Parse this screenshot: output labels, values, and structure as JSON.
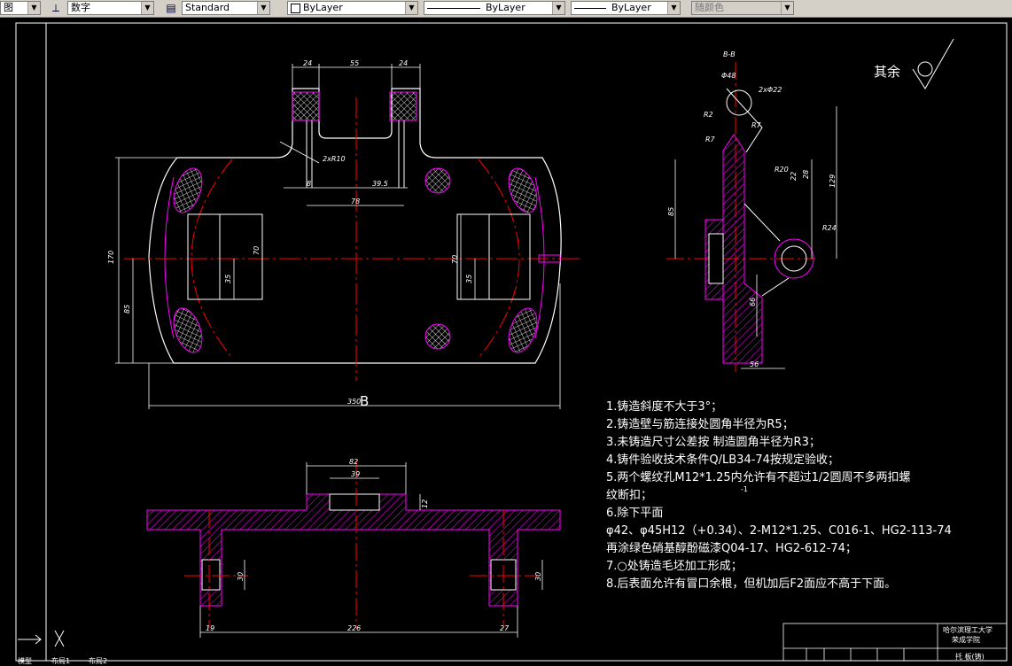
{
  "toolbar": {
    "partial_left": "图",
    "dimstyle_value": "数字",
    "textstyle_value": "Standard",
    "layer_value": "ByLayer",
    "linetype_value": "ByLayer",
    "lineweight_value": "ByLayer",
    "plotstyle_value": "随颜色"
  },
  "drawing": {
    "view_label": "B",
    "roughness_note": "其余",
    "dims": {
      "top_24a": "24",
      "top_55": "55",
      "top_24b": "24",
      "r10": "2xR10",
      "d8": "8",
      "d39_5": "39.5",
      "d78": "78",
      "d170": "170",
      "d85": "85",
      "d70a": "70",
      "d35a": "35",
      "d70b": "70",
      "d35b": "35",
      "d350": "350",
      "d82": "82",
      "d39": "39",
      "d12": "12",
      "d226": "226",
      "d19": "19",
      "d27": "27",
      "d30a": "30",
      "d30b": "30",
      "side_22": "2xΦ22",
      "side_r2": "R2",
      "side_r7": "R7",
      "side_r7b": "R7",
      "side_r20": "R20",
      "side_22b": "22",
      "side_28": "28",
      "side_85": "85",
      "side_129": "129",
      "side_r24": "R24",
      "side_66": "66",
      "side_56": "56",
      "side_48": "Φ48",
      "side_sec": "B-B"
    }
  },
  "notes": [
    "1.铸造斜度不大于3°；",
    "2.铸造壁与筋连接处圆角半径为R5；",
    "3.未铸造尺寸公差按    制造圆角半径为R3；",
    "4.铸件验收技术条件Q/LB34-74按规定验收；",
    "5.两个螺纹孔M12*1.25内允许有不超过1/2圆周不多两扣螺",
    "纹断扣；",
    "6.除下平面",
    "φ42、φ45H12（+0.34）、2-M12*1.25、C016-1、HG2-113-74",
    "再涂绿色硝基醇酚磁漆Q04-17、HG2-612-74；",
    "7.○处铸造毛坯加工形成；",
    "8.后表面允许有冒口余根，但机加后F2面应不高于下面。"
  ],
  "note_sup": "-1",
  "title_block": {
    "school": "哈尔滨理工大学",
    "college": "荣成学院",
    "part_name": "托  板(铸)"
  },
  "tabs": [
    "模型",
    "布局1",
    "布局2"
  ],
  "colors": {
    "background": "#000000",
    "lines": "#ffffff",
    "centerline": "#ff0000",
    "hatch": "#ff00ff"
  }
}
